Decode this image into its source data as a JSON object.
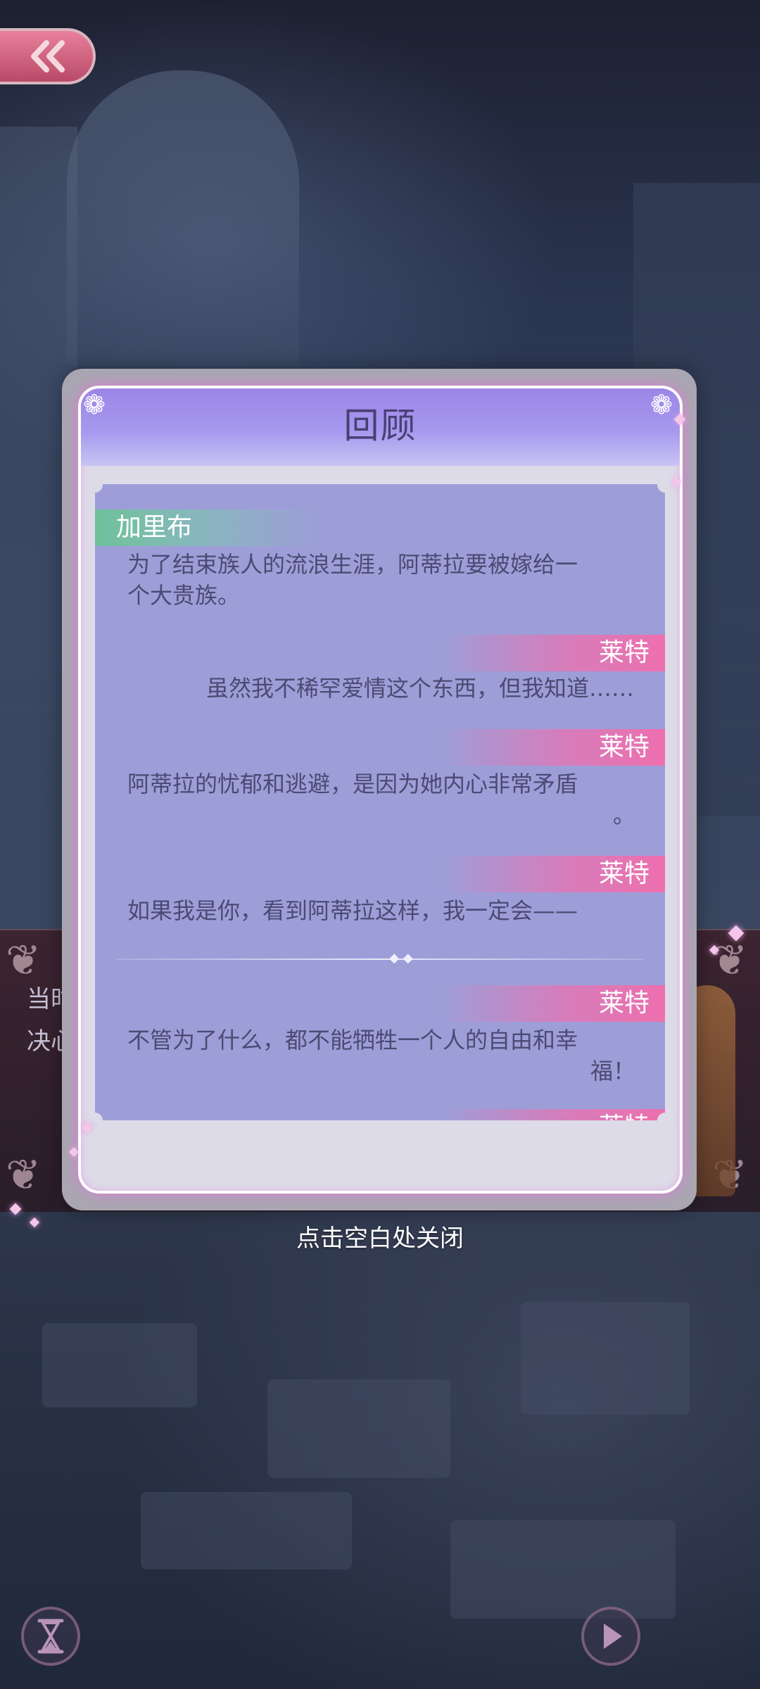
{
  "modal": {
    "title": "回顾",
    "close_hint": "点击空白处关闭",
    "entries": [
      {
        "speaker": "加里布",
        "side": "left",
        "text": "为了结束族人的流浪生涯，阿蒂拉要被嫁给一\n个大贵族。"
      },
      {
        "speaker": "莱特",
        "side": "right",
        "text": "虽然我不稀罕爱情这个东西，但我知道……"
      },
      {
        "speaker": "莱特",
        "side": "right",
        "text": "阿蒂拉的忧郁和逃避，是因为她内心非常矛盾\n。"
      },
      {
        "speaker": "莱特",
        "side": "right",
        "text": "如果我是你，看到阿蒂拉这样，我一定会——"
      },
      {
        "speaker": "莱特",
        "side": "right",
        "text": "不管为了什么，都不能牺牲一个人的自由和幸\n福！"
      },
      {
        "speaker": "莱特",
        "side": "right",
        "text": ""
      }
    ]
  },
  "background": {
    "dialog_text": "当时\n决心"
  },
  "icons": {
    "back": "double-chevron-left-icon",
    "hourglass": "hourglass-icon",
    "play": "play-icon"
  },
  "colors": {
    "header": "#9c86e6",
    "list_bg": "#9d9ed8",
    "left_tag": "#6fc19a",
    "right_tag": "#ee6fae",
    "text": "#4b4a73"
  }
}
